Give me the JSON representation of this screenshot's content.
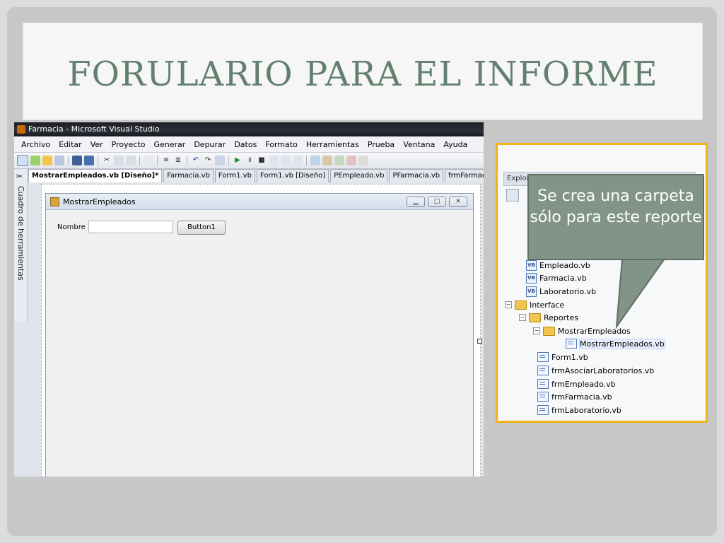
{
  "slide_title": "FORULARIO PARA EL INFORME",
  "window": {
    "title": "Farmacia - Microsoft Visual Studio",
    "menu": [
      "Archivo",
      "Editar",
      "Ver",
      "Proyecto",
      "Generar",
      "Depurar",
      "Datos",
      "Formato",
      "Herramientas",
      "Prueba",
      "Ventana",
      "Ayuda"
    ],
    "toolbox_label": "Cuadro de herramientas",
    "tabs": [
      "MostrarEmpleados.vb [Diseño]*",
      "Farmacia.vb",
      "Form1.vb",
      "Form1.vb [Diseño]",
      "PEmpleado.vb",
      "PFarmacia.vb",
      "frmFarmacia.vb"
    ]
  },
  "form": {
    "title": "MostrarEmpleados",
    "label_nombre": "Nombre",
    "button_label": "Button1"
  },
  "solution_explorer": {
    "header": "Explor",
    "items": {
      "empleado": "Empleado.vb",
      "farmacia": "Farmacia.vb",
      "laboratorio": "Laboratorio.vb",
      "interface": "Interface",
      "reportes": "Reportes",
      "mostrar_folder": "MostrarEmpleados",
      "mostrar_file": "MostrarEmpleados.vb",
      "form1": "Form1.vb",
      "frm_asociar": "frmAsociarLaboratorios.vb",
      "frm_empleado": "frmEmpleado.vb",
      "frm_farmacia": "frmFarmacia.vb",
      "frm_laboratorio": "frmLaboratorio.vb"
    }
  },
  "callout_text": "Se crea una carpeta sólo para este reporte",
  "colors": {
    "title": "#63806f",
    "highlight_border": "#f2b21b",
    "callout_fill": "#829487"
  }
}
